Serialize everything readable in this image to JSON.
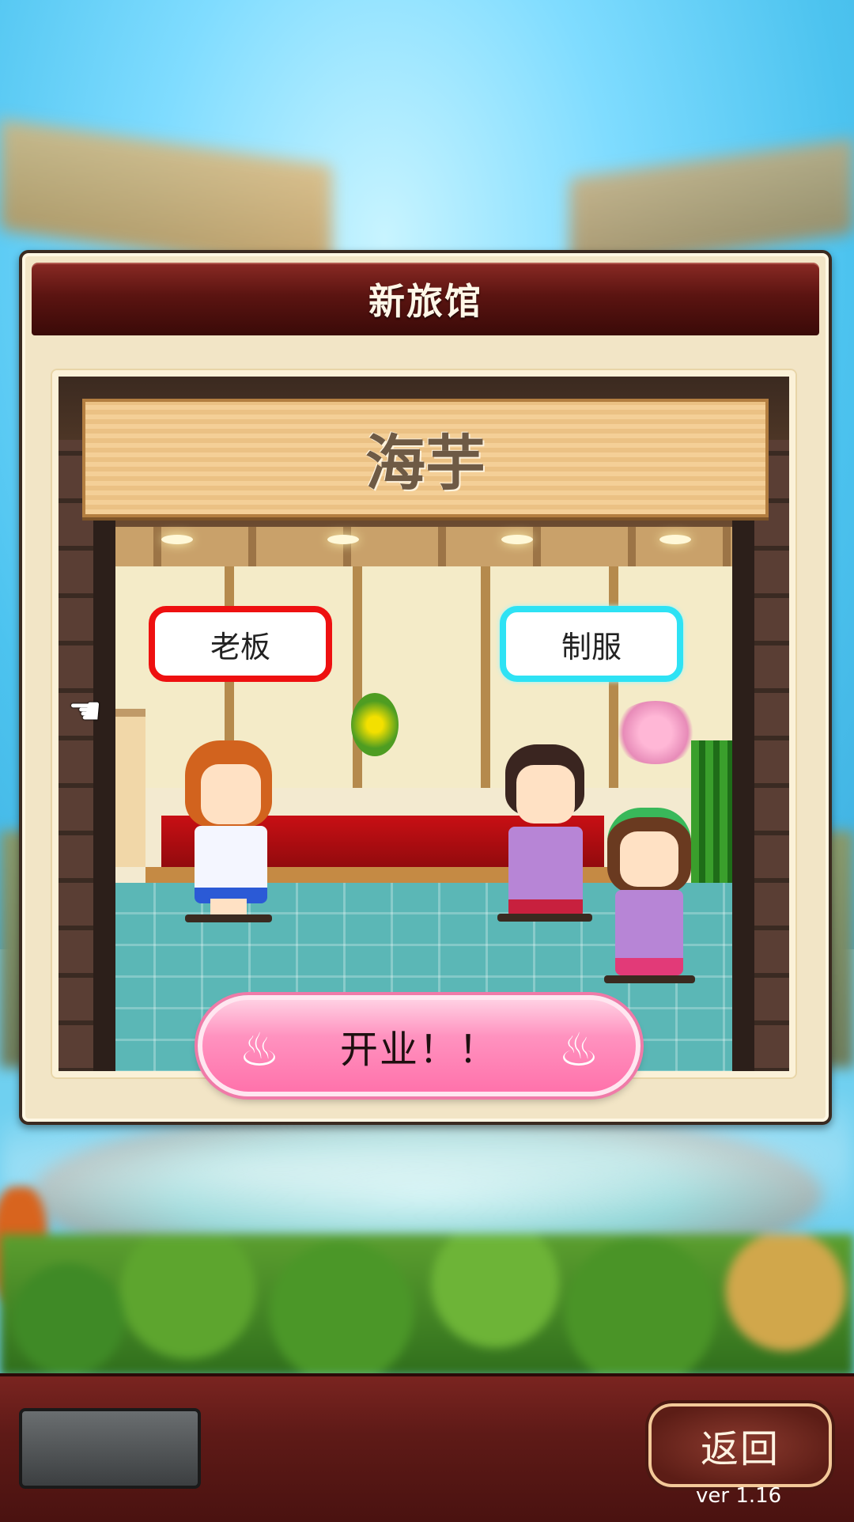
{
  "dialog": {
    "title": "新旅馆",
    "inn_name": "海芋",
    "owner_label": "老板",
    "uniform_label": "制服",
    "open_button_label": "开业！！",
    "open_button_icon": "onsen-steam-icon"
  },
  "bottom_bar": {
    "back_label": "返回",
    "version": "ver 1.16"
  },
  "colors": {
    "header": "#5b1411",
    "owner_border": "#ee1010",
    "uniform_border": "#2ee2f4",
    "open_button": "#ff7fb2",
    "bottom_bar": "#5e1a17"
  }
}
